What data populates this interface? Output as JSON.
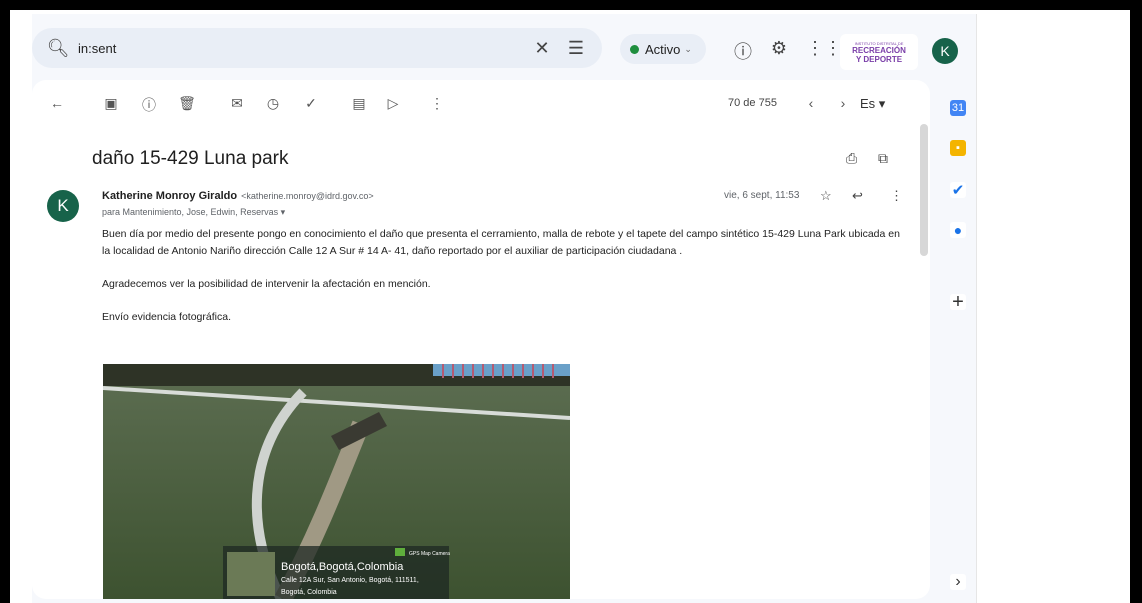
{
  "search": {
    "query": "in:sent",
    "icon": "search-icon"
  },
  "status": {
    "label": "Activo",
    "color": "#1e8e3e"
  },
  "org_logo": {
    "line1": "INSTITUTO DISTRITAL DE",
    "line2": "RECREACIÓN",
    "line3": "Y DEPORTE"
  },
  "account_initial": "K",
  "toolbar": {
    "counter": "70 de 755",
    "lang": "Es"
  },
  "email": {
    "subject": "daño 15-429 Luna park",
    "sender_name": "Katherine Monroy Giraldo",
    "sender_email": "<katherine.monroy@idrd.gov.co>",
    "recipients": "para Mantenimiento, Jose, Edwin, Reservas",
    "date": "vie, 6 sept, 11:53",
    "avatar_initial": "K",
    "paragraphs": [
      "Buen día por medio del presente pongo en  conocimiento el daño  que presenta el cerramiento, malla de rebote y el tapete  del campo sintético 15-429 Luna Park ubicada en  la localidad de Antonio Nariño dirección Calle 12 A Sur # 14 A- 41, daño  reportado por el auxiliar de participación ciudadana .",
      "Agradecemos  ver la posibilidad de intervenir la afectación en mención.",
      "Envío evidencia fotográfica."
    ]
  },
  "photo": {
    "badge": "GPS Map Camera",
    "location": "Bogotá,Bogotá,Colombia",
    "address": "Calle 12A Sur, San Antonio, Bogotá, 111511,",
    "address2": "Bogotá, Colombia"
  }
}
